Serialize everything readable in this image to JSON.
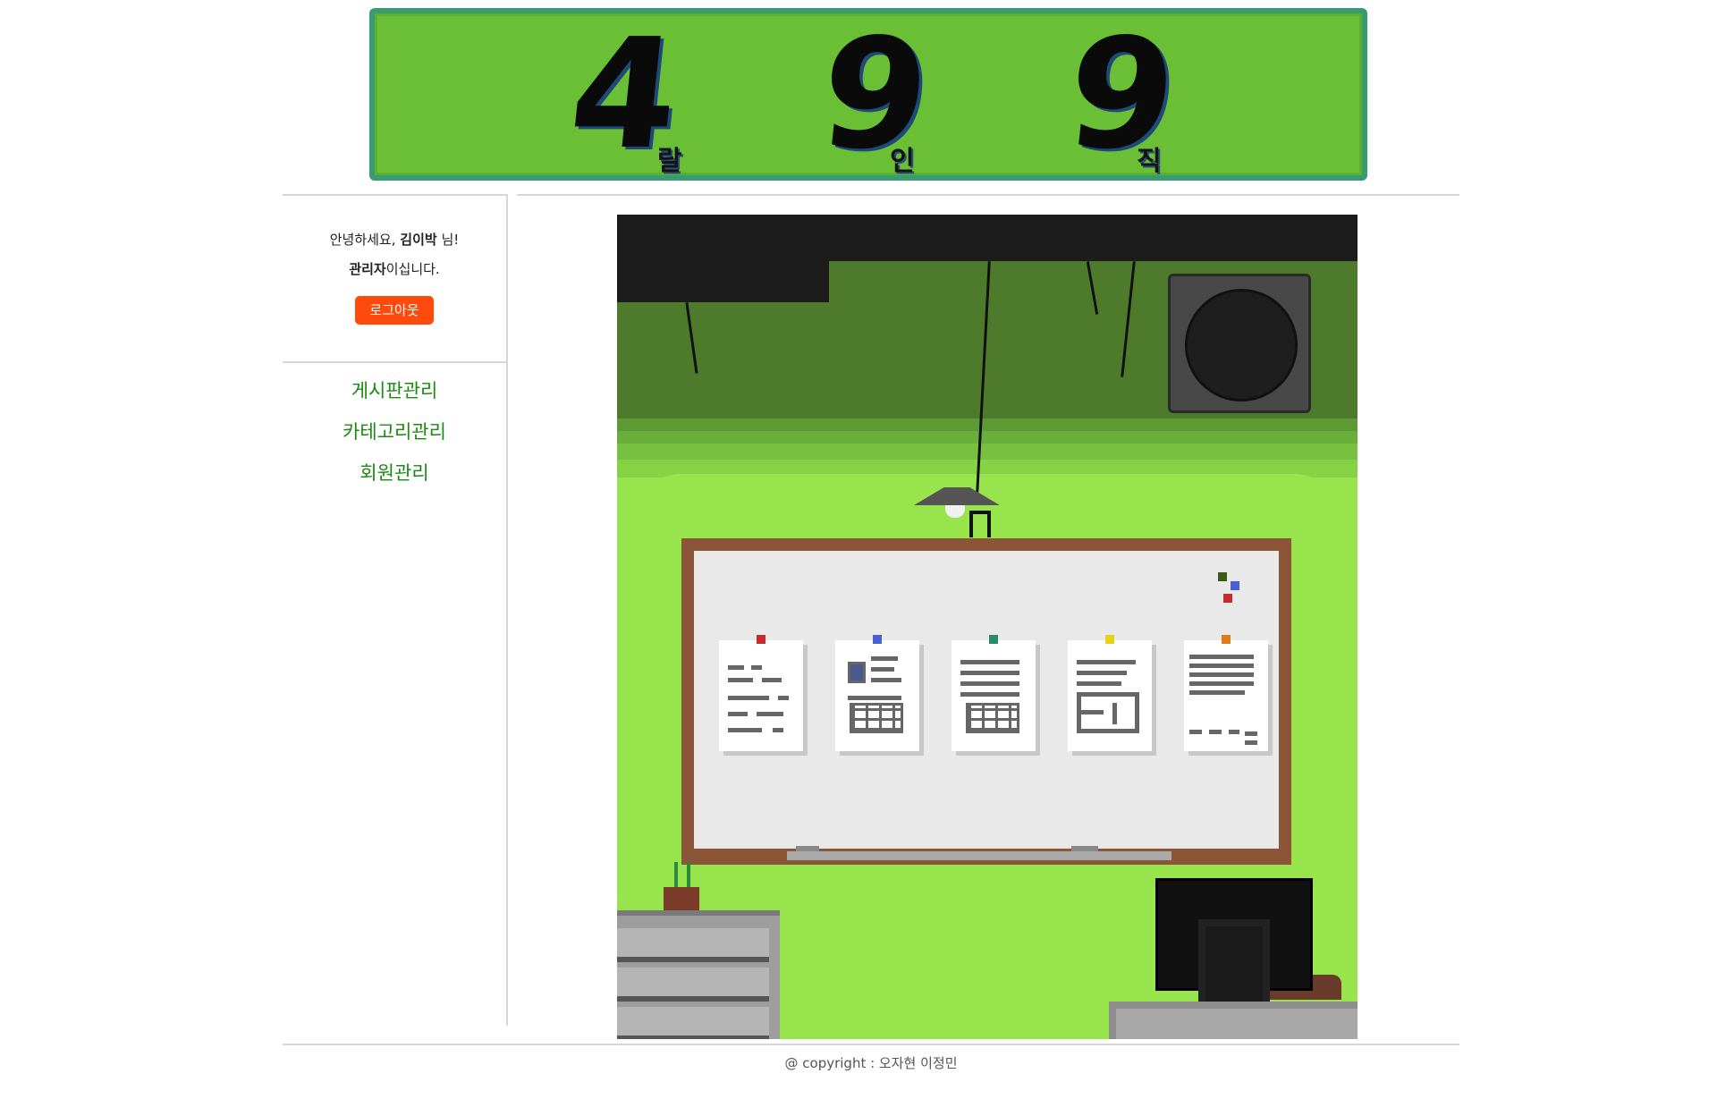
{
  "banner": {
    "digits": [
      "4",
      "9",
      "9"
    ],
    "subs": [
      "랄",
      "인",
      "직"
    ]
  },
  "sidebar": {
    "greeting_prefix": "안녕하세요, ",
    "user_name": "김이박",
    "greeting_suffix": " 님!",
    "role_bold": "관리자",
    "role_suffix": "이십니다.",
    "logout_label": "로그아웃",
    "menu": [
      {
        "label": "게시판관리"
      },
      {
        "label": "카테고리관리"
      },
      {
        "label": "회원관리"
      }
    ]
  },
  "footer": {
    "copyright": "@ copyright : 오자현 이정민"
  },
  "colors": {
    "accent_logout": "#ff4a0d",
    "menu_link": "#1b8a12",
    "banner_green": "#6abf34",
    "banner_border": "#3a9a72"
  }
}
